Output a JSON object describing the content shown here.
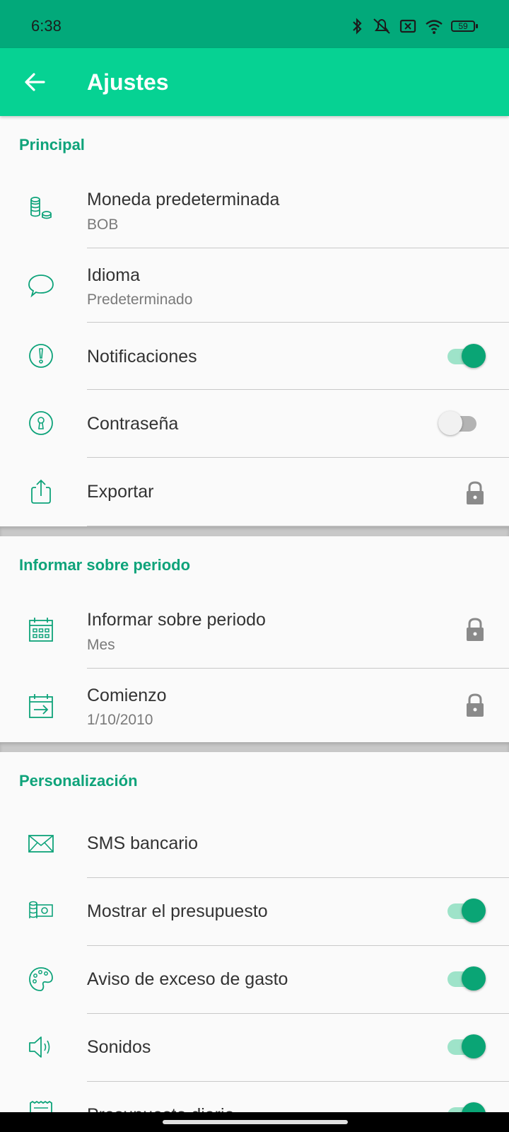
{
  "status": {
    "time": "6:38",
    "battery": "59"
  },
  "appbar": {
    "title": "Ajustes"
  },
  "sections": {
    "principal": "Principal",
    "periodo": "Informar sobre periodo",
    "personalizacion": "Personalización"
  },
  "items": {
    "moneda": {
      "label": "Moneda predeterminada",
      "sub": "BOB"
    },
    "idioma": {
      "label": "Idioma",
      "sub": "Predeterminado"
    },
    "notificaciones": {
      "label": "Notificaciones",
      "enabled": true
    },
    "contrasena": {
      "label": "Contraseña",
      "enabled": false
    },
    "exportar": {
      "label": "Exportar",
      "locked": true
    },
    "periodo": {
      "label": "Informar sobre periodo",
      "sub": "Mes",
      "locked": true
    },
    "comienzo": {
      "label": "Comienzo",
      "sub": "1/10/2010",
      "locked": true
    },
    "sms": {
      "label": "SMS bancario"
    },
    "presupuesto": {
      "label": "Mostrar el presupuesto",
      "enabled": true
    },
    "aviso": {
      "label": "Aviso de exceso de gasto",
      "enabled": true
    },
    "sonidos": {
      "label": "Sonidos",
      "enabled": true
    },
    "partial": {
      "label": "Presupuesto diario",
      "enabled": true
    }
  },
  "colors": {
    "accent": "#06d293",
    "status": "#02a97a",
    "section": "#0ea37a",
    "toggle_on": "#0aa575"
  },
  "icons": [
    "back-arrow-icon",
    "coins-icon",
    "speech-bubble-icon",
    "exclamation-icon",
    "keyhole-icon",
    "share-icon",
    "lock-icon",
    "calendar-icon",
    "calendar-arrow-icon",
    "envelope-icon",
    "money-icon",
    "palette-icon",
    "speaker-icon",
    "receipt-icon"
  ]
}
